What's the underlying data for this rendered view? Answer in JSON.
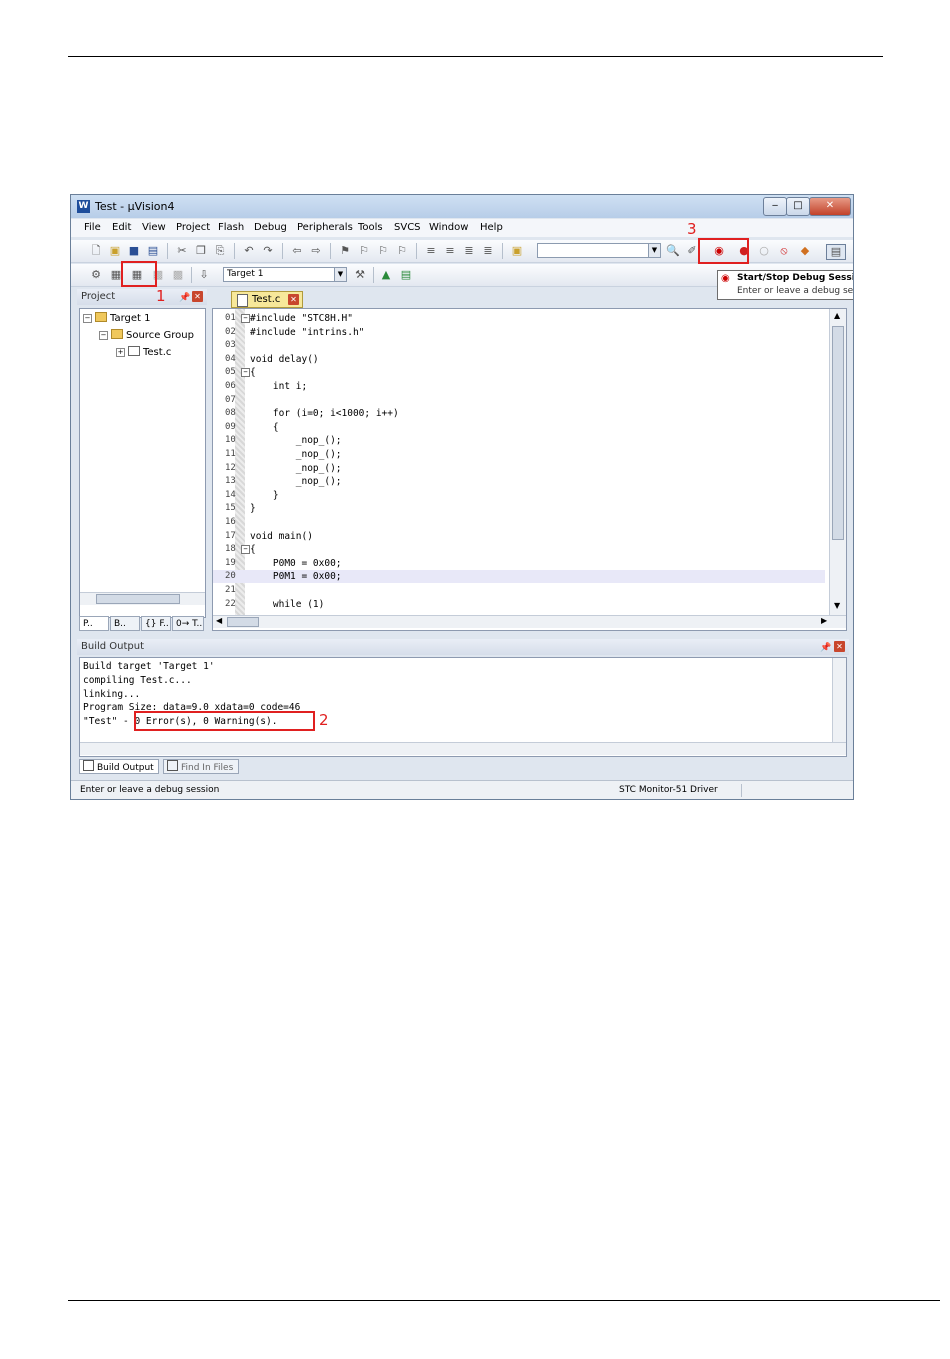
{
  "window": {
    "title": "Test  - µVision4"
  },
  "menu": [
    "File",
    "Edit",
    "View",
    "Project",
    "Flash",
    "Debug",
    "Peripherals",
    "Tools",
    "SVCS",
    "Window",
    "Help"
  ],
  "toolbar": {
    "target_value": "Target 1"
  },
  "tooltip": {
    "title": "Start/Stop Debug Session (",
    "desc": "Enter or leave a debug sess"
  },
  "project": {
    "header": "Project",
    "tree": [
      {
        "label": "Target 1"
      },
      {
        "label": "Source Group"
      },
      {
        "label": "Test.c"
      }
    ],
    "tabs": [
      "P..",
      "B..",
      "{} F..",
      "0→ T.."
    ]
  },
  "editor": {
    "tab": "Test.c",
    "lines": [
      {
        "n": "01",
        "text": "#include \"STC8H.H\""
      },
      {
        "n": "02",
        "text": "#include \"intrins.h\""
      },
      {
        "n": "03",
        "text": ""
      },
      {
        "n": "04",
        "text": "void delay()"
      },
      {
        "n": "05",
        "text": "{"
      },
      {
        "n": "06",
        "text": "    int i;"
      },
      {
        "n": "07",
        "text": ""
      },
      {
        "n": "08",
        "text": "    for (i=0; i<1000; i++)"
      },
      {
        "n": "09",
        "text": "    {"
      },
      {
        "n": "10",
        "text": "        _nop_();"
      },
      {
        "n": "11",
        "text": "        _nop_();"
      },
      {
        "n": "12",
        "text": "        _nop_();"
      },
      {
        "n": "13",
        "text": "        _nop_();"
      },
      {
        "n": "14",
        "text": "    }"
      },
      {
        "n": "15",
        "text": "}"
      },
      {
        "n": "16",
        "text": ""
      },
      {
        "n": "17",
        "text": "void main()"
      },
      {
        "n": "18",
        "text": "{"
      },
      {
        "n": "19",
        "text": "    P0M0 = 0x00;"
      },
      {
        "n": "20",
        "text": "    P0M1 = 0x00;"
      },
      {
        "n": "21",
        "text": ""
      },
      {
        "n": "22",
        "text": "    while (1)"
      }
    ]
  },
  "build": {
    "header": "Build Output",
    "lines": [
      "Build target 'Target 1'",
      "compiling Test.c...",
      "linking...",
      "Program Size: data=9.0 xdata=0 code=46",
      "\"Test\" - 0 Error(s), 0 Warning(s)."
    ],
    "tabs": [
      "Build Output",
      "Find In Files"
    ]
  },
  "status": {
    "left": "Enter or leave a debug session",
    "driver": "STC Monitor-51 Driver"
  },
  "annotations": [
    "1",
    "2",
    "3"
  ]
}
